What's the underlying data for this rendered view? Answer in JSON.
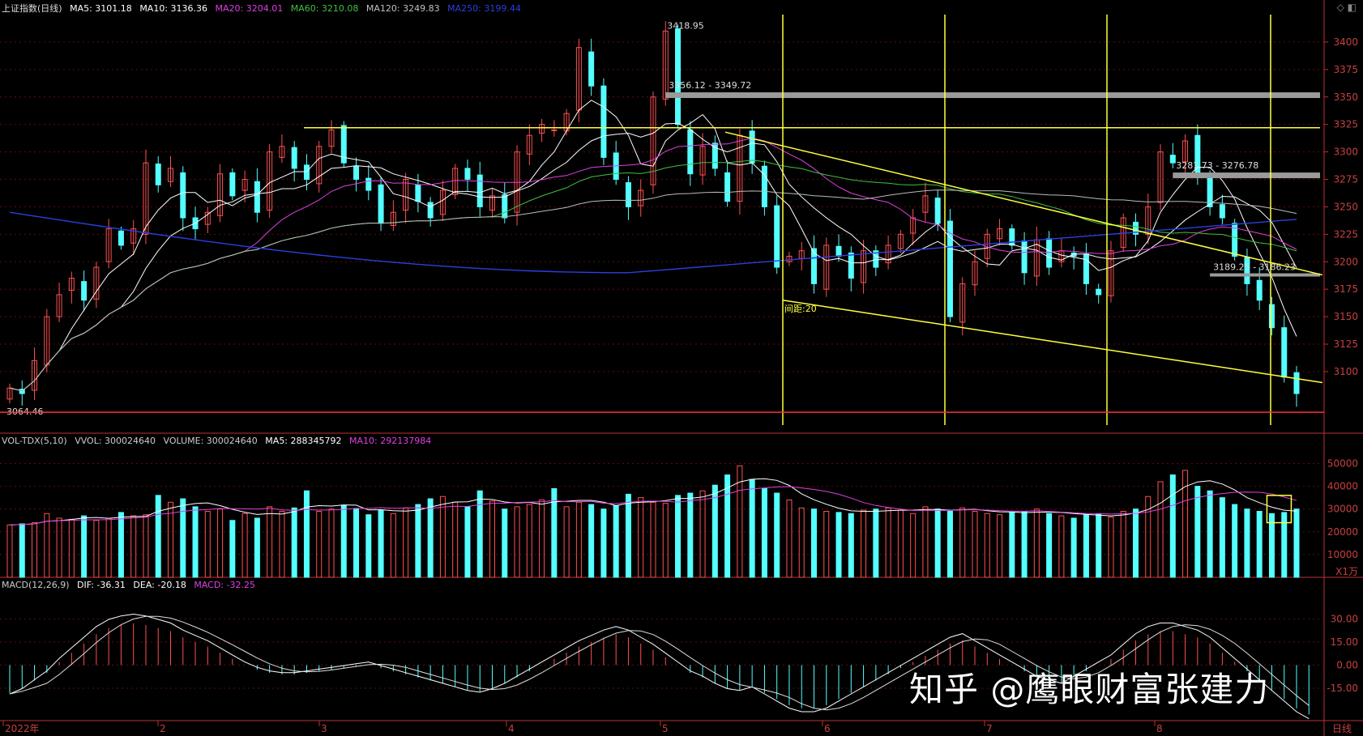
{
  "header": {
    "title": "上证指数(日线)",
    "ma": [
      {
        "label": "MA5: 3101.18",
        "color": "#ffffff"
      },
      {
        "label": "MA10: 3136.36",
        "color": "#ffffff"
      },
      {
        "label": "MA20: 3204.01",
        "color": "#e040e0"
      },
      {
        "label": "MA60: 3210.08",
        "color": "#40c040"
      },
      {
        "label": "MA120: 3249.83",
        "color": "#c0c0c0"
      },
      {
        "label": "MA250: 3199.44",
        "color": "#2b3fe0"
      }
    ],
    "corner_icons": "◇ ◧"
  },
  "vol_header": [
    {
      "label": "VOL-TDX(5,10)",
      "color": "#cccccc"
    },
    {
      "label": "VVOL: 300024640",
      "color": "#cccccc"
    },
    {
      "label": "VOLUME: 300024640",
      "color": "#cccccc"
    },
    {
      "label": "MA5: 288345792",
      "color": "#ffffff"
    },
    {
      "label": "MA10: 292137984",
      "color": "#e040e0"
    }
  ],
  "macd_header": [
    {
      "label": "MACD(12,26,9)",
      "color": "#cccccc"
    },
    {
      "label": "DIF: -36.31",
      "color": "#ffffff"
    },
    {
      "label": "DEA: -20.18",
      "color": "#ffffff"
    },
    {
      "label": "MACD: -32.25",
      "color": "#e040e0"
    }
  ],
  "watermark": "知乎 @鹰眼财富张建力",
  "colors": {
    "up": "#ff5050",
    "down": "#54ffff",
    "axis": "#c03030",
    "yellow": "#ffff40",
    "grid": "#5a1010"
  },
  "chart_data": [
    {
      "type": "candlestick",
      "title": "上证指数(日线)",
      "x_months": [
        "2022年",
        "2",
        "3",
        "4",
        "5",
        "6",
        "7",
        "8"
      ],
      "y_ticks": [
        3100,
        3125,
        3150,
        3175,
        3200,
        3225,
        3250,
        3275,
        3300,
        3325,
        3350,
        3375,
        3400
      ],
      "ylim": [
        3055,
        3425
      ],
      "annotations": {
        "high": "3418.95",
        "low": "3064.46",
        "resist1": "3356.12 - 3349.72",
        "resist2": "3281.73 - 3276.78",
        "support": "3189.25 - 3186.23",
        "spacing": "间距:20"
      },
      "close_path": [
        3085,
        3080,
        3110,
        3150,
        3170,
        3185,
        3165,
        3195,
        3230,
        3215,
        3230,
        3290,
        3270,
        3285,
        3240,
        3230,
        3245,
        3280,
        3260,
        3275,
        3245,
        3300,
        3305,
        3285,
        3275,
        3305,
        3320,
        3290,
        3275,
        3265,
        3235,
        3245,
        3275,
        3255,
        3240,
        3265,
        3285,
        3275,
        3250,
        3260,
        3240,
        3300,
        3315,
        3325,
        3320,
        3335,
        3395,
        3360,
        3295,
        3275,
        3250,
        3265,
        3350,
        3410,
        3325,
        3280,
        3305,
        3285,
        3255,
        3315,
        3290,
        3250,
        3195,
        3205,
        3210,
        3180,
        3215,
        3205,
        3185,
        3210,
        3195,
        3215,
        3225,
        3240,
        3260,
        3235,
        3150,
        3180,
        3200,
        3225,
        3230,
        3215,
        3190,
        3220,
        3195,
        3210,
        3205,
        3180,
        3170,
        3210,
        3240,
        3225,
        3250,
        3300,
        3290,
        3310,
        3280,
        3250,
        3240,
        3205,
        3180,
        3165,
        3140,
        3095,
        3080
      ],
      "series_ma": [
        "MA5",
        "MA10",
        "MA20",
        "MA60",
        "MA120",
        "MA250"
      ]
    },
    {
      "type": "bar",
      "title": "VOL-TDX(5,10)",
      "y_ticks": [
        10000,
        20000,
        30000,
        40000,
        50000
      ],
      "unit": "X1万",
      "ylim": [
        0,
        58000
      ],
      "values": [
        23000,
        23500,
        24000,
        28000,
        26000,
        25500,
        27000,
        25000,
        26000,
        28500,
        27000,
        27500,
        36000,
        33000,
        34500,
        31000,
        29000,
        30000,
        25000,
        28000,
        26000,
        31000,
        29000,
        30500,
        38000,
        29000,
        30000,
        31500,
        30000,
        27500,
        29500,
        28000,
        30500,
        32000,
        34500,
        35500,
        33000,
        31000,
        38000,
        33500,
        30000,
        31000,
        32000,
        34000,
        39000,
        31000,
        33000,
        32000,
        30000,
        31500,
        36500,
        35000,
        33000,
        32500,
        36000,
        37000,
        38000,
        40500,
        45000,
        49000,
        43000,
        39000,
        37000,
        34000,
        30500,
        30000,
        29000,
        28500,
        28000,
        29500,
        30000,
        30500,
        29500,
        28000,
        31000,
        30000,
        29000,
        30500,
        29000,
        28000,
        27500,
        28500,
        29000,
        30000,
        28000,
        27000,
        26000,
        27500,
        28000,
        26500,
        29000,
        30000,
        35500,
        42000,
        45000,
        47000,
        40000,
        38000,
        35000,
        32000,
        30000,
        29000,
        28000,
        28500,
        30000
      ],
      "ma_lines": [
        "MA5",
        "MA10"
      ]
    },
    {
      "type": "bar",
      "title": "MACD(12,26,9)",
      "y_ticks": [
        -15.0,
        0.0,
        15.0,
        30.0
      ],
      "ylim": [
        -36,
        48
      ],
      "x_label": "日线",
      "values": [
        -18,
        -15,
        -10,
        -5,
        2,
        8,
        14,
        20,
        24,
        26,
        27,
        26,
        24,
        22,
        18,
        15,
        12,
        8,
        4,
        0,
        -3,
        -5,
        -6,
        -6,
        -5,
        -4,
        -3,
        -2,
        -1,
        0,
        -2,
        -4,
        -6,
        -8,
        -10,
        -12,
        -14,
        -16,
        -17,
        -15,
        -12,
        -8,
        -4,
        0,
        4,
        8,
        12,
        15,
        18,
        20,
        18,
        14,
        10,
        5,
        0,
        -5,
        -8,
        -12,
        -15,
        -16,
        -14,
        -18,
        -22,
        -26,
        -28,
        -28,
        -26,
        -22,
        -18,
        -14,
        -10,
        -6,
        -2,
        2,
        6,
        10,
        14,
        16,
        12,
        8,
        4,
        0,
        -4,
        -8,
        -10,
        -12,
        -8,
        -4,
        0,
        4,
        10,
        16,
        20,
        22,
        22,
        20,
        18,
        14,
        8,
        2,
        -4,
        -10,
        -16,
        -22,
        -28,
        -32
      ],
      "lines": [
        "DIF",
        "DEA"
      ]
    }
  ]
}
